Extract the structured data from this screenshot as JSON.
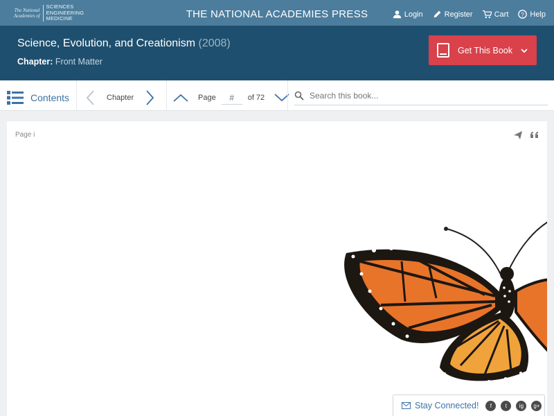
{
  "brand": {
    "logo_left_line1": "The National",
    "logo_left_line2": "Academies of",
    "logo_right_line1": "SCIENCES",
    "logo_right_line2": "ENGINEERING",
    "logo_right_line3": "MEDICINE",
    "press_title": "THE NATIONAL ACADEMIES PRESS"
  },
  "topnav": {
    "login": "Login",
    "register": "Register",
    "cart": "Cart",
    "help": "Help"
  },
  "book": {
    "title": "Science, Evolution, and Creationism",
    "year": "(2008)",
    "chapter_label": "Chapter:",
    "chapter_name": "Front Matter",
    "get_book_label": "Get This Book"
  },
  "toolbar": {
    "contents_label": "Contents",
    "chapter_label": "Chapter",
    "page_label": "Page",
    "page_placeholder": "#",
    "page_total": "of 72",
    "search_placeholder": "Search this book..."
  },
  "page_view": {
    "page_label": "Page i"
  },
  "footer": {
    "stay_connected": "Stay Connected!",
    "social": [
      "f",
      "t",
      "ig",
      "g+"
    ]
  },
  "colors": {
    "topbar": "#4c7d9d",
    "bookbar": "#1f4f6e",
    "accent_red": "#d9414b",
    "link_blue": "#3d72a6"
  }
}
